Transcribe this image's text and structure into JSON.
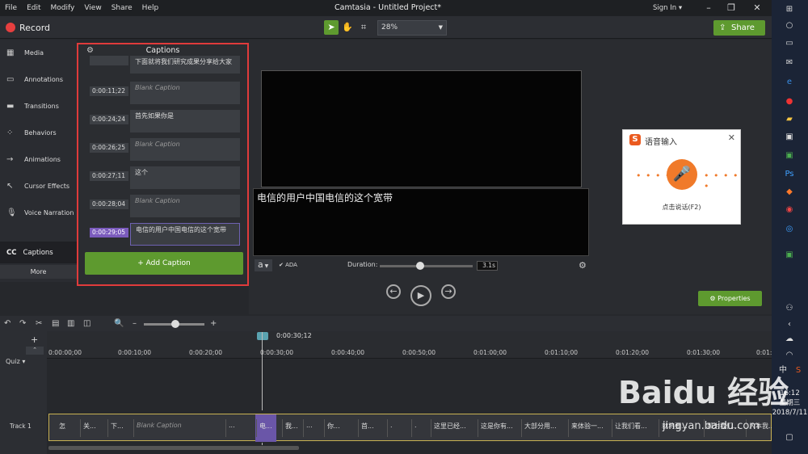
{
  "menu": [
    "File",
    "Edit",
    "Modify",
    "View",
    "Share",
    "Help"
  ],
  "app_title": "Camtasia - Untitled Project*",
  "signin": "Sign In ▾",
  "record_label": "Record",
  "zoom": "28%",
  "share_label": "Share",
  "nav": [
    {
      "label": "Media",
      "icon": "film-icon"
    },
    {
      "label": "Annotations",
      "icon": "annotation-icon"
    },
    {
      "label": "Transitions",
      "icon": "transition-icon"
    },
    {
      "label": "Behaviors",
      "icon": "behavior-icon"
    },
    {
      "label": "Animations",
      "icon": "animation-icon"
    },
    {
      "label": "Cursor Effects",
      "icon": "cursor-icon"
    },
    {
      "label": "Voice Narration",
      "icon": "mic-icon"
    }
  ],
  "captions_nav": "Captions",
  "captions_nav_icon": "CC",
  "more_label": "More",
  "captions_panel": {
    "title": "Captions",
    "add_button": "Add Caption",
    "rows": [
      {
        "time": "",
        "text": "下面就将我们研究成果分享给大家",
        "blank": false
      },
      {
        "time": "0:00:11;22",
        "text": "Blank Caption",
        "blank": true
      },
      {
        "time": "0:00:24;24",
        "text": "首先如果你是",
        "blank": false
      },
      {
        "time": "0:00:26;25",
        "text": "Blank Caption",
        "blank": true
      },
      {
        "time": "0:00:27;11",
        "text": "这个",
        "blank": false
      },
      {
        "time": "0:00:28;04",
        "text": "Blank Caption",
        "blank": true
      },
      {
        "time": "0:00:29;05",
        "text": "电信的用户中国电信的这个宽带",
        "blank": false,
        "selected": true
      }
    ]
  },
  "caption_edit_text": "电信的用户中国电信的这个宽带",
  "font_btn": "a",
  "ada_label": "ADA",
  "duration_label": "Duration:",
  "duration_value": "3.1s",
  "duration_fraction": 0.45,
  "properties_label": "Properties",
  "ime": {
    "title": "语音输入",
    "tip": "点击说话(F2)"
  },
  "timeline": {
    "playhead_time": "0:00:30;12",
    "zoom_fraction": 0.5,
    "ticks": [
      "0:00:00;00",
      "0:00:10;00",
      "0:00:20;00",
      "0:00:30;00",
      "0:00:40;00",
      "0:00:50;00",
      "0:01:00;00",
      "0:01:10;00",
      "0:01:20;00",
      "0:01:30;00",
      "0:01:"
    ],
    "quiz_label": "Quiz",
    "track_label": "Track 1",
    "clips": [
      "怎",
      "关...",
      "下...",
      "Blank Caption",
      "...",
      "电...",
      "我...",
      "...",
      "你...",
      "首...",
      ".",
      ".",
      "这里已经...",
      "这是你有...",
      "大部分用...",
      "来体验一...",
      "让我们看...",
      "就将要...",
      "那为我们...",
      "人本我..."
    ]
  },
  "taskbar": {
    "time": "16:12",
    "weekday": "星期三",
    "date": "2018/7/11",
    "lang": "中"
  },
  "watermark": {
    "brand": "Baidu 经验",
    "url": "jingyan.baidu.com"
  }
}
